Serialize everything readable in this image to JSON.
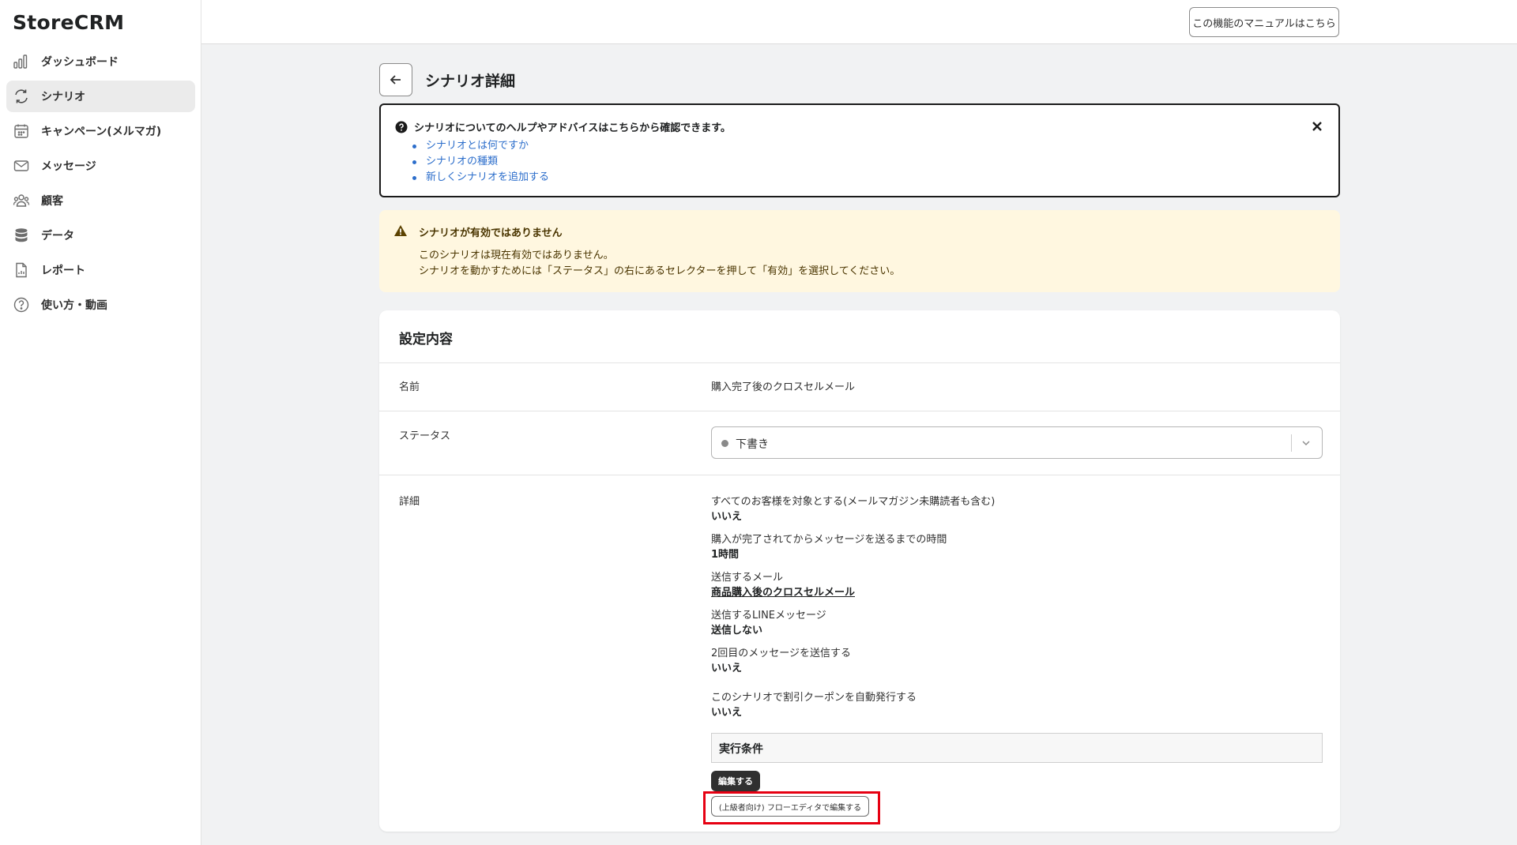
{
  "app": {
    "logo": "StoreCRM"
  },
  "sidebar": {
    "items": [
      {
        "label": "ダッシュボード",
        "icon": "bar-chart-icon"
      },
      {
        "label": "シナリオ",
        "icon": "refresh-icon",
        "active": true
      },
      {
        "label": "キャンペーン(メルマガ)",
        "icon": "calendar-icon"
      },
      {
        "label": "メッセージ",
        "icon": "envelope-icon"
      },
      {
        "label": "顧客",
        "icon": "people-icon"
      },
      {
        "label": "データ",
        "icon": "database-icon"
      },
      {
        "label": "レポート",
        "icon": "report-icon"
      },
      {
        "label": "使い方・動画",
        "icon": "help-circle-icon"
      }
    ]
  },
  "topbar": {
    "manual_label": "この機能のマニュアルはこちら"
  },
  "page": {
    "title": "シナリオ詳細"
  },
  "help": {
    "heading": "シナリオについてのヘルプやアドバイスはこちらから確認できます。",
    "links": [
      "シナリオとは何ですか",
      "シナリオの種類",
      "新しくシナリオを追加する"
    ]
  },
  "warning": {
    "title": "シナリオが有効ではありません",
    "line1": "このシナリオは現在有効ではありません。",
    "line2": "シナリオを動かすためには「ステータス」の右にあるセレクターを押して「有効」を選択してください。",
    "color": "#fff7e0"
  },
  "settings": {
    "title": "設定内容",
    "name_label": "名前",
    "name_value": "購入完了後のクロスセルメール",
    "status_label": "ステータス",
    "status_value": "下書き",
    "details_label": "詳細",
    "details": [
      {
        "label": "すべてのお客様を対象とする(メールマガジン未購読者も含む)",
        "value": "いいえ"
      },
      {
        "label": "購入が完了されてからメッセージを送るまでの時間",
        "value": "1時間"
      },
      {
        "label": "送信するメール",
        "value": "商品購入後のクロスセルメール",
        "link": true
      },
      {
        "label": "送信するLINEメッセージ",
        "value": "送信しない"
      },
      {
        "label": "2回目のメッセージを送信する",
        "value": "いいえ"
      },
      {
        "label": "このシナリオで割引クーポンを自動発行する",
        "value": "いいえ"
      }
    ],
    "condition_title": "実行条件",
    "edit_label": "編集する",
    "flow_editor_label": "(上級者向け) フローエディタで編集する"
  },
  "colors": {
    "highlight": "#e60012",
    "link": "#2c6ecb"
  }
}
